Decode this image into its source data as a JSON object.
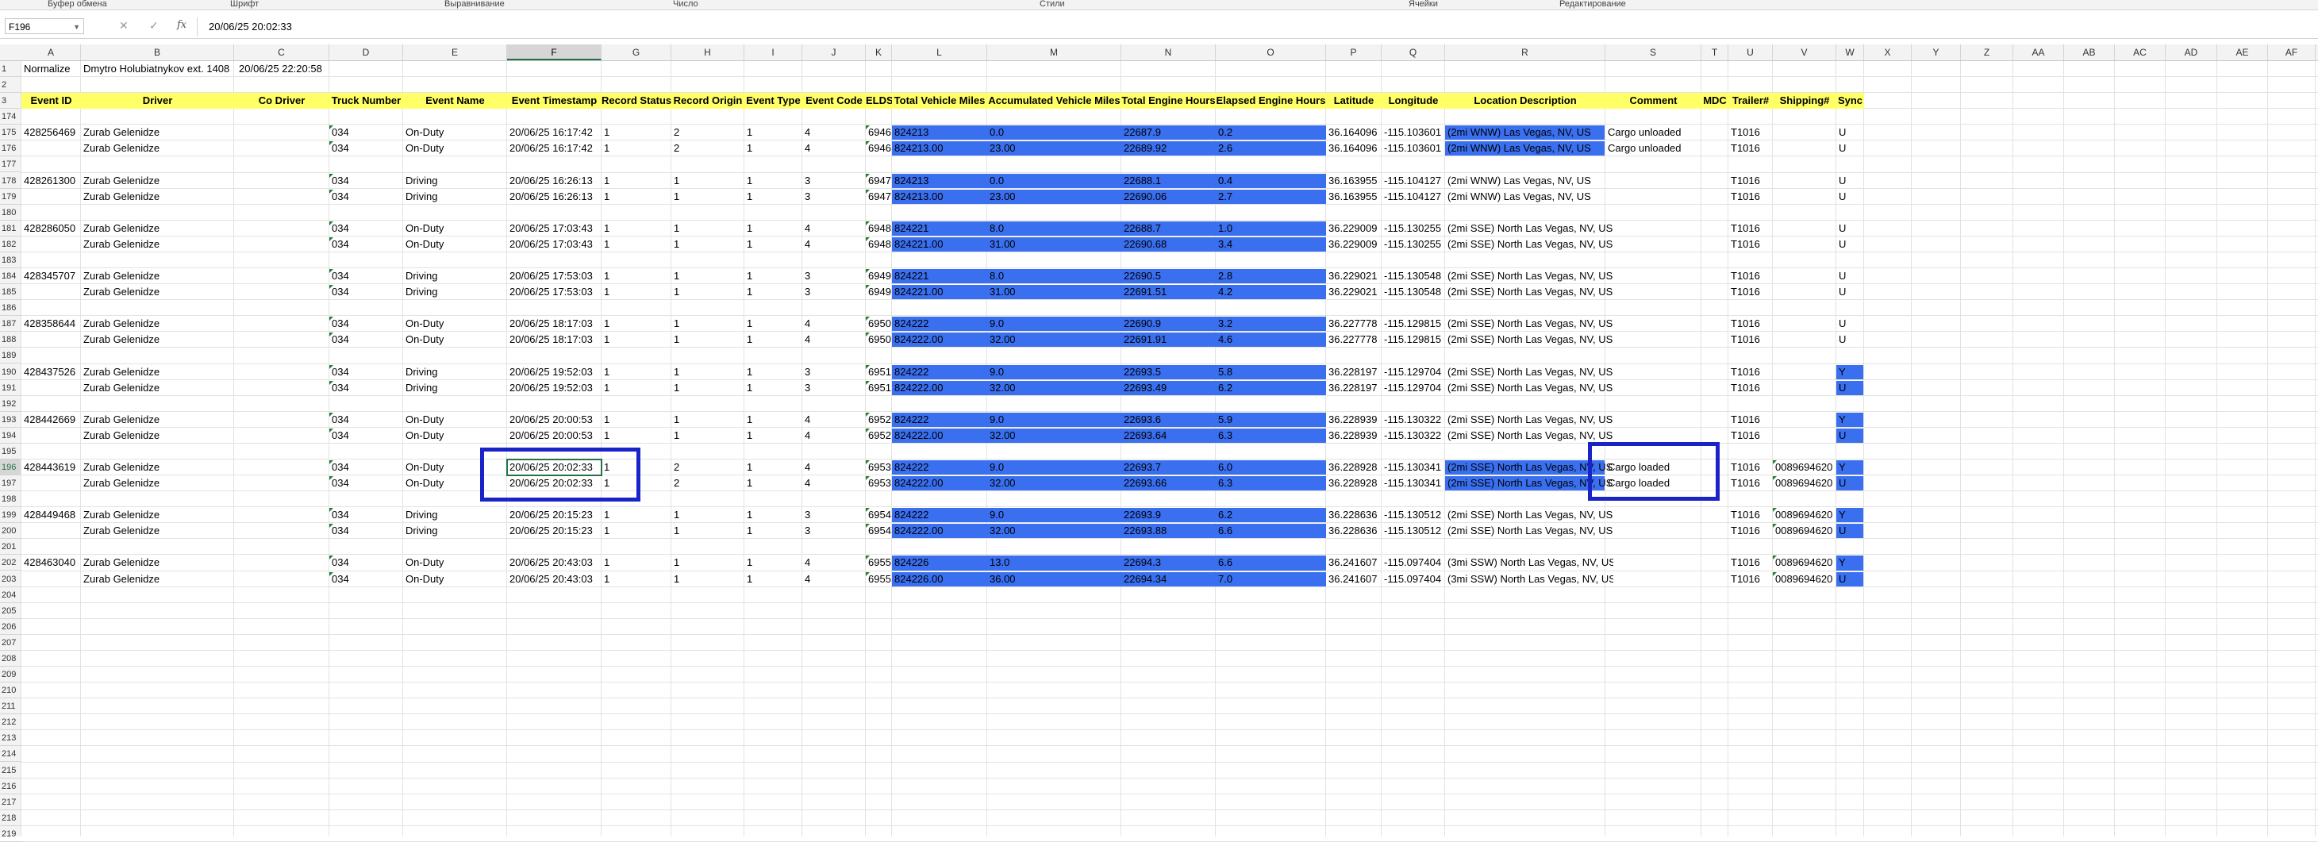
{
  "ribbon": {
    "groups": [
      "Буфер обмена",
      "Шрифт",
      "Выравнивание",
      "Число",
      "Стили",
      "Ячейки",
      "Редактирование"
    ]
  },
  "formula_bar": {
    "name_box": "F196",
    "fx": "fx",
    "cancel": "✕",
    "enter": "✓",
    "value": "20/06/25 20:02:33"
  },
  "columns": [
    "A",
    "B",
    "C",
    "D",
    "E",
    "F",
    "G",
    "H",
    "I",
    "J",
    "K",
    "L",
    "M",
    "N",
    "O",
    "P",
    "Q",
    "R",
    "S",
    "T",
    "U",
    "V",
    "W",
    "X",
    "Y",
    "Z",
    "AA",
    "AB",
    "AC",
    "AD",
    "AE",
    "AF"
  ],
  "selected_column": "F",
  "selected_row": "196",
  "row_numbers": [
    "1",
    "2",
    "3",
    "174",
    "175",
    "176",
    "177",
    "178",
    "179",
    "180",
    "181",
    "182",
    "183",
    "184",
    "185",
    "186",
    "187",
    "188",
    "189",
    "190",
    "191",
    "192",
    "193",
    "194",
    "195",
    "196",
    "197",
    "198",
    "199",
    "200",
    "201",
    "202",
    "203",
    "204",
    "205",
    "206",
    "207",
    "208",
    "209",
    "210",
    "211",
    "212",
    "213",
    "214",
    "215",
    "216",
    "217",
    "218",
    "219"
  ],
  "row1": {
    "a": "Normalize",
    "b": "Dmytro Holubiatnykov ext. 1408",
    "c": "20/06/25 22:20:58"
  },
  "headers": [
    "Event ID",
    "Driver",
    "Co Driver",
    "Truck Number",
    "Event Name",
    "Event Timestamp",
    "Record Status",
    "Record Origin",
    "Event Type",
    "Event Code",
    "ELDS",
    "Total Vehicle Miles",
    "Accumulated Vehicle Miles",
    "Total Engine Hours",
    "Elapsed Engine Hours",
    "Latitude",
    "Longitude",
    "Location Description",
    "Comment",
    "MDC",
    "Trailer#",
    "Shipping#",
    "Sync"
  ],
  "rows": [
    {
      "r": 4,
      "id": "428256469",
      "driver": "Zurab Gelenidze",
      "truck": "034",
      "event": "On-Duty",
      "ts": "20/06/25 16:17:42",
      "status": "1",
      "origin": "2",
      "type": "1",
      "code": "4",
      "elds": "6946",
      "tvm": "824213",
      "avm": "0.0",
      "teh": "22687.9",
      "eeh": "0.2",
      "lat": "36.164096",
      "lon": "-115.103601",
      "loc": "(2mi WNW) Las Vegas, NV, US",
      "comment": "Cargo unloaded",
      "trailer": "T1016",
      "ship": "",
      "sync": "U",
      "locblue": true,
      "syncblue": false
    },
    {
      "r": 5,
      "id": "",
      "driver": "Zurab Gelenidze",
      "truck": "034",
      "event": "On-Duty",
      "ts": "20/06/25 16:17:42",
      "status": "1",
      "origin": "2",
      "type": "1",
      "code": "4",
      "elds": "6946",
      "tvm": "824213.00",
      "avm": "23.00",
      "teh": "22689.92",
      "eeh": "2.6",
      "lat": "36.164096",
      "lon": "-115.103601",
      "loc": "(2mi WNW) Las Vegas, NV, US",
      "comment": "Cargo unloaded",
      "trailer": "T1016",
      "ship": "",
      "sync": "U",
      "locblue": true,
      "syncblue": false
    },
    {
      "r": 7,
      "id": "428261300",
      "driver": "Zurab Gelenidze",
      "truck": "034",
      "event": "Driving",
      "ts": "20/06/25 16:26:13",
      "status": "1",
      "origin": "1",
      "type": "1",
      "code": "3",
      "elds": "6947",
      "tvm": "824213",
      "avm": "0.0",
      "teh": "22688.1",
      "eeh": "0.4",
      "lat": "36.163955",
      "lon": "-115.104127",
      "loc": "(2mi WNW) Las Vegas, NV, US",
      "comment": "",
      "trailer": "T1016",
      "ship": "",
      "sync": "U",
      "locblue": false,
      "syncblue": false
    },
    {
      "r": 8,
      "id": "",
      "driver": "Zurab Gelenidze",
      "truck": "034",
      "event": "Driving",
      "ts": "20/06/25 16:26:13",
      "status": "1",
      "origin": "1",
      "type": "1",
      "code": "3",
      "elds": "6947",
      "tvm": "824213.00",
      "avm": "23.00",
      "teh": "22690.06",
      "eeh": "2.7",
      "lat": "36.163955",
      "lon": "-115.104127",
      "loc": "(2mi WNW) Las Vegas, NV, US",
      "comment": "",
      "trailer": "T1016",
      "ship": "",
      "sync": "U",
      "locblue": false,
      "syncblue": false
    },
    {
      "r": 10,
      "id": "428286050",
      "driver": "Zurab Gelenidze",
      "truck": "034",
      "event": "On-Duty",
      "ts": "20/06/25 17:03:43",
      "status": "1",
      "origin": "1",
      "type": "1",
      "code": "4",
      "elds": "6948",
      "tvm": "824221",
      "avm": "8.0",
      "teh": "22688.7",
      "eeh": "1.0",
      "lat": "36.229009",
      "lon": "-115.130255",
      "loc": "(2mi SSE) North Las Vegas, NV, US",
      "comment": "",
      "trailer": "T1016",
      "ship": "",
      "sync": "U",
      "locblue": false,
      "syncblue": false
    },
    {
      "r": 11,
      "id": "",
      "driver": "Zurab Gelenidze",
      "truck": "034",
      "event": "On-Duty",
      "ts": "20/06/25 17:03:43",
      "status": "1",
      "origin": "1",
      "type": "1",
      "code": "4",
      "elds": "6948",
      "tvm": "824221.00",
      "avm": "31.00",
      "teh": "22690.68",
      "eeh": "3.4",
      "lat": "36.229009",
      "lon": "-115.130255",
      "loc": "(2mi SSE) North Las Vegas, NV, US",
      "comment": "",
      "trailer": "T1016",
      "ship": "",
      "sync": "U",
      "locblue": false,
      "syncblue": false
    },
    {
      "r": 13,
      "id": "428345707",
      "driver": "Zurab Gelenidze",
      "truck": "034",
      "event": "Driving",
      "ts": "20/06/25 17:53:03",
      "status": "1",
      "origin": "1",
      "type": "1",
      "code": "3",
      "elds": "6949",
      "tvm": "824221",
      "avm": "8.0",
      "teh": "22690.5",
      "eeh": "2.8",
      "lat": "36.229021",
      "lon": "-115.130548",
      "loc": "(2mi SSE) North Las Vegas, NV, US",
      "comment": "",
      "trailer": "T1016",
      "ship": "",
      "sync": "U",
      "locblue": false,
      "syncblue": false
    },
    {
      "r": 14,
      "id": "",
      "driver": "Zurab Gelenidze",
      "truck": "034",
      "event": "Driving",
      "ts": "20/06/25 17:53:03",
      "status": "1",
      "origin": "1",
      "type": "1",
      "code": "3",
      "elds": "6949",
      "tvm": "824221.00",
      "avm": "31.00",
      "teh": "22691.51",
      "eeh": "4.2",
      "lat": "36.229021",
      "lon": "-115.130548",
      "loc": "(2mi SSE) North Las Vegas, NV, US",
      "comment": "",
      "trailer": "T1016",
      "ship": "",
      "sync": "U",
      "locblue": false,
      "syncblue": false
    },
    {
      "r": 16,
      "id": "428358644",
      "driver": "Zurab Gelenidze",
      "truck": "034",
      "event": "On-Duty",
      "ts": "20/06/25 18:17:03",
      "status": "1",
      "origin": "1",
      "type": "1",
      "code": "4",
      "elds": "6950",
      "tvm": "824222",
      "avm": "9.0",
      "teh": "22690.9",
      "eeh": "3.2",
      "lat": "36.227778",
      "lon": "-115.129815",
      "loc": "(2mi SSE) North Las Vegas, NV, US",
      "comment": "",
      "trailer": "T1016",
      "ship": "",
      "sync": "U",
      "locblue": false,
      "syncblue": false
    },
    {
      "r": 17,
      "id": "",
      "driver": "Zurab Gelenidze",
      "truck": "034",
      "event": "On-Duty",
      "ts": "20/06/25 18:17:03",
      "status": "1",
      "origin": "1",
      "type": "1",
      "code": "4",
      "elds": "6950",
      "tvm": "824222.00",
      "avm": "32.00",
      "teh": "22691.91",
      "eeh": "4.6",
      "lat": "36.227778",
      "lon": "-115.129815",
      "loc": "(2mi SSE) North Las Vegas, NV, US",
      "comment": "",
      "trailer": "T1016",
      "ship": "",
      "sync": "U",
      "locblue": false,
      "syncblue": false
    },
    {
      "r": 19,
      "id": "428437526",
      "driver": "Zurab Gelenidze",
      "truck": "034",
      "event": "Driving",
      "ts": "20/06/25 19:52:03",
      "status": "1",
      "origin": "1",
      "type": "1",
      "code": "3",
      "elds": "6951",
      "tvm": "824222",
      "avm": "9.0",
      "teh": "22693.5",
      "eeh": "5.8",
      "lat": "36.228197",
      "lon": "-115.129704",
      "loc": "(2mi SSE) North Las Vegas, NV, US",
      "comment": "",
      "trailer": "T1016",
      "ship": "",
      "sync": "Y",
      "locblue": false,
      "syncblue": true
    },
    {
      "r": 20,
      "id": "",
      "driver": "Zurab Gelenidze",
      "truck": "034",
      "event": "Driving",
      "ts": "20/06/25 19:52:03",
      "status": "1",
      "origin": "1",
      "type": "1",
      "code": "3",
      "elds": "6951",
      "tvm": "824222.00",
      "avm": "32.00",
      "teh": "22693.49",
      "eeh": "6.2",
      "lat": "36.228197",
      "lon": "-115.129704",
      "loc": "(2mi SSE) North Las Vegas, NV, US",
      "comment": "",
      "trailer": "T1016",
      "ship": "",
      "sync": "U",
      "locblue": false,
      "syncblue": true
    },
    {
      "r": 22,
      "id": "428442669",
      "driver": "Zurab Gelenidze",
      "truck": "034",
      "event": "On-Duty",
      "ts": "20/06/25 20:00:53",
      "status": "1",
      "origin": "1",
      "type": "1",
      "code": "4",
      "elds": "6952",
      "tvm": "824222",
      "avm": "9.0",
      "teh": "22693.6",
      "eeh": "5.9",
      "lat": "36.228939",
      "lon": "-115.130322",
      "loc": "(2mi SSE) North Las Vegas, NV, US",
      "comment": "",
      "trailer": "T1016",
      "ship": "",
      "sync": "Y",
      "locblue": false,
      "syncblue": true
    },
    {
      "r": 23,
      "id": "",
      "driver": "Zurab Gelenidze",
      "truck": "034",
      "event": "On-Duty",
      "ts": "20/06/25 20:00:53",
      "status": "1",
      "origin": "1",
      "type": "1",
      "code": "4",
      "elds": "6952",
      "tvm": "824222.00",
      "avm": "32.00",
      "teh": "22693.64",
      "eeh": "6.3",
      "lat": "36.228939",
      "lon": "-115.130322",
      "loc": "(2mi SSE) North Las Vegas, NV, US",
      "comment": "",
      "trailer": "T1016",
      "ship": "",
      "sync": "U",
      "locblue": false,
      "syncblue": true
    },
    {
      "r": 25,
      "id": "428443619",
      "driver": "Zurab Gelenidze",
      "truck": "034",
      "event": "On-Duty",
      "ts": "20/06/25 20:02:33",
      "status": "1",
      "origin": "2",
      "type": "1",
      "code": "4",
      "elds": "6953",
      "tvm": "824222",
      "avm": "9.0",
      "teh": "22693.7",
      "eeh": "6.0",
      "lat": "36.228928",
      "lon": "-115.130341",
      "loc": "(2mi SSE) North Las Vegas, NV, US",
      "comment": "Cargo loaded",
      "trailer": "T1016",
      "ship": "0089694620",
      "sync": "Y",
      "locblue": true,
      "syncblue": true
    },
    {
      "r": 26,
      "id": "",
      "driver": "Zurab Gelenidze",
      "truck": "034",
      "event": "On-Duty",
      "ts": "20/06/25 20:02:33",
      "status": "1",
      "origin": "2",
      "type": "1",
      "code": "4",
      "elds": "6953",
      "tvm": "824222.00",
      "avm": "32.00",
      "teh": "22693.66",
      "eeh": "6.3",
      "lat": "36.228928",
      "lon": "-115.130341",
      "loc": "(2mi SSE) North Las Vegas, NV, US",
      "comment": "Cargo loaded",
      "trailer": "T1016",
      "ship": "0089694620",
      "sync": "U",
      "locblue": true,
      "syncblue": true
    },
    {
      "r": 28,
      "id": "428449468",
      "driver": "Zurab Gelenidze",
      "truck": "034",
      "event": "Driving",
      "ts": "20/06/25 20:15:23",
      "status": "1",
      "origin": "1",
      "type": "1",
      "code": "3",
      "elds": "6954",
      "tvm": "824222",
      "avm": "9.0",
      "teh": "22693.9",
      "eeh": "6.2",
      "lat": "36.228636",
      "lon": "-115.130512",
      "loc": "(2mi SSE) North Las Vegas, NV, US",
      "comment": "",
      "trailer": "T1016",
      "ship": "0089694620",
      "sync": "Y",
      "locblue": false,
      "syncblue": true
    },
    {
      "r": 29,
      "id": "",
      "driver": "Zurab Gelenidze",
      "truck": "034",
      "event": "Driving",
      "ts": "20/06/25 20:15:23",
      "status": "1",
      "origin": "1",
      "type": "1",
      "code": "3",
      "elds": "6954",
      "tvm": "824222.00",
      "avm": "32.00",
      "teh": "22693.88",
      "eeh": "6.6",
      "lat": "36.228636",
      "lon": "-115.130512",
      "loc": "(2mi SSE) North Las Vegas, NV, US",
      "comment": "",
      "trailer": "T1016",
      "ship": "0089694620",
      "sync": "U",
      "locblue": false,
      "syncblue": true
    },
    {
      "r": 31,
      "id": "428463040",
      "driver": "Zurab Gelenidze",
      "truck": "034",
      "event": "On-Duty",
      "ts": "20/06/25 20:43:03",
      "status": "1",
      "origin": "1",
      "type": "1",
      "code": "4",
      "elds": "6955",
      "tvm": "824226",
      "avm": "13.0",
      "teh": "22694.3",
      "eeh": "6.6",
      "lat": "36.241607",
      "lon": "-115.097404",
      "loc": "(3mi SSW) North Las Vegas, NV, US",
      "comment": "",
      "trailer": "T1016",
      "ship": "0089694620",
      "sync": "Y",
      "locblue": false,
      "syncblue": true
    },
    {
      "r": 32,
      "id": "",
      "driver": "Zurab Gelenidze",
      "truck": "034",
      "event": "On-Duty",
      "ts": "20/06/25 20:43:03",
      "status": "1",
      "origin": "1",
      "type": "1",
      "code": "4",
      "elds": "6955",
      "tvm": "824226.00",
      "avm": "36.00",
      "teh": "22694.34",
      "eeh": "7.0",
      "lat": "36.241607",
      "lon": "-115.097404",
      "loc": "(3mi SSW) North Las Vegas, NV, US",
      "comment": "",
      "trailer": "T1016",
      "ship": "0089694620",
      "sync": "U",
      "locblue": false,
      "syncblue": true
    }
  ]
}
